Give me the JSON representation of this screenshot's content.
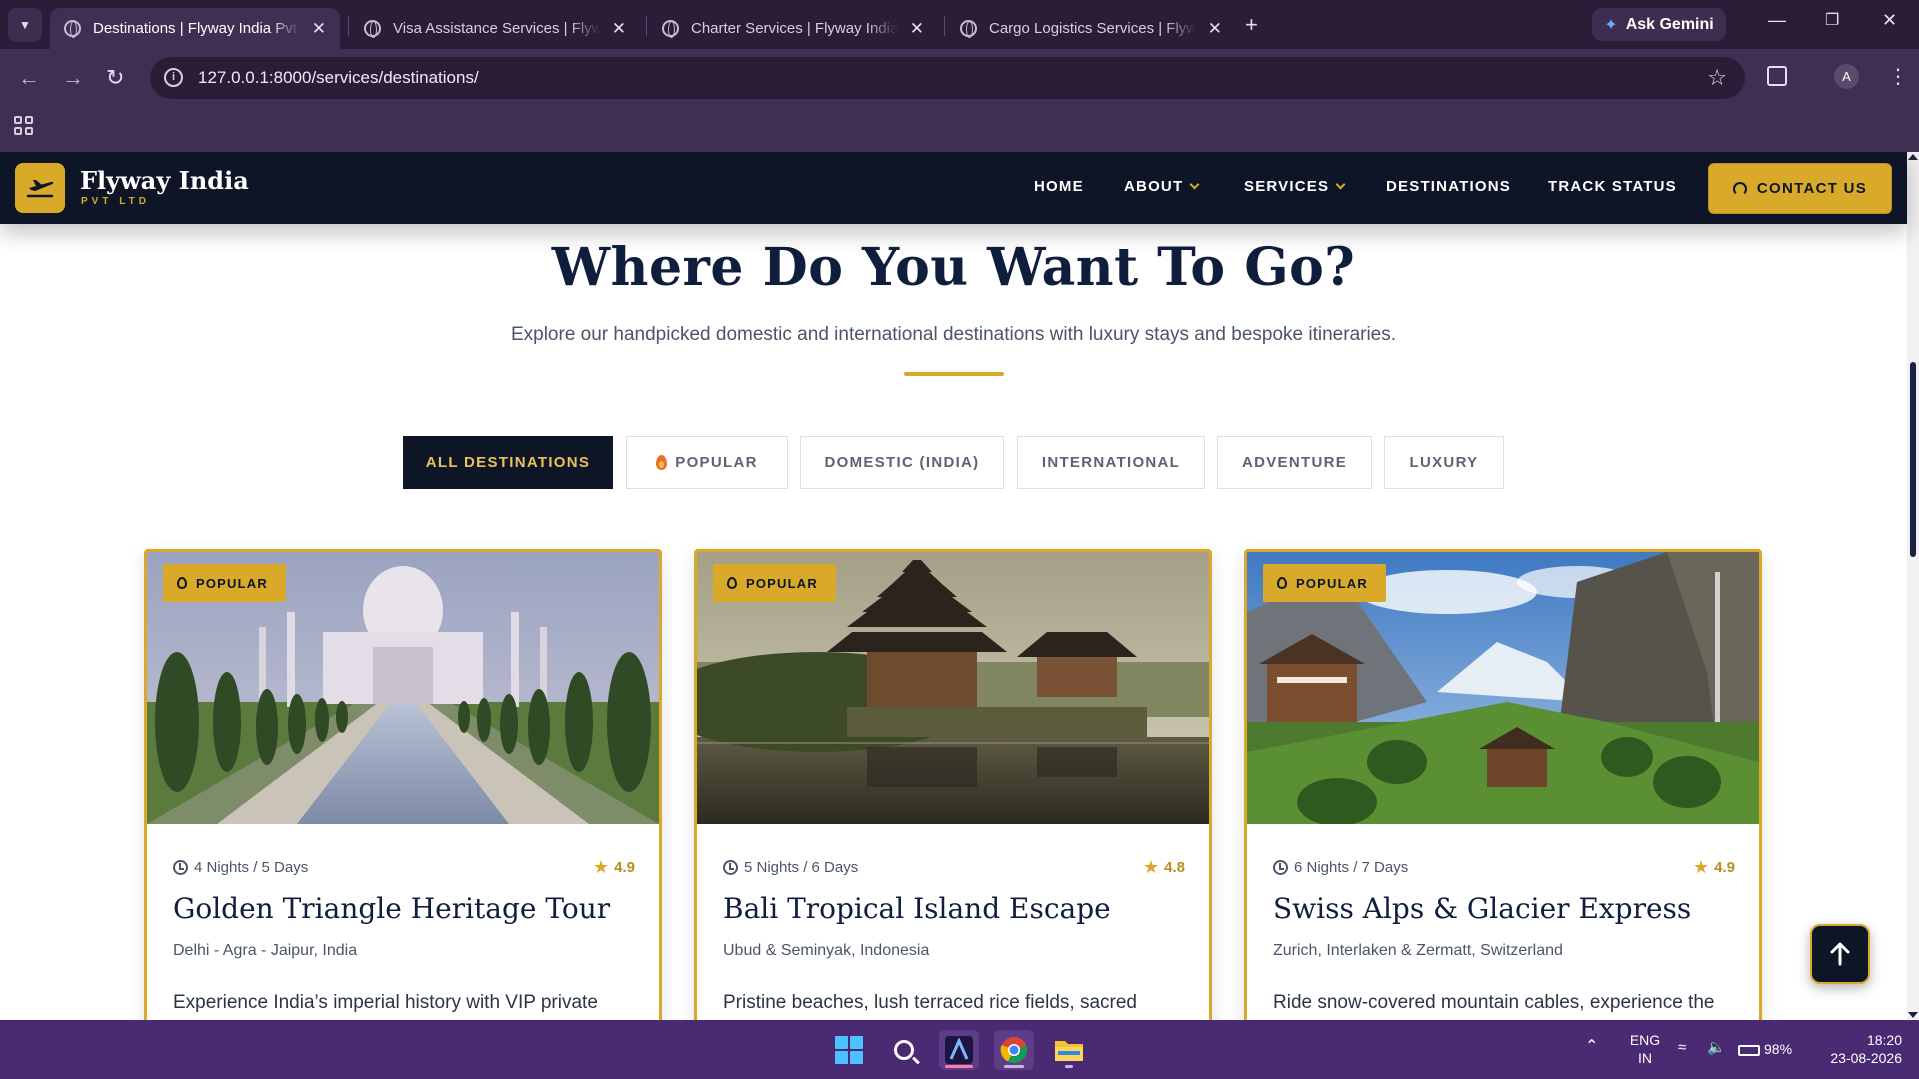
{
  "browser": {
    "tabs": [
      {
        "title": "Destinations | Flyway India Pvt Ltd",
        "active": true
      },
      {
        "title": "Visa Assistance Services | Flyway India",
        "active": false
      },
      {
        "title": "Charter Services | Flyway India Pvt Ltd",
        "active": false
      },
      {
        "title": "Cargo Logistics Services | Flyway India",
        "active": false
      }
    ],
    "ask_gemini": "Ask Gemini",
    "url": "127.0.0.1:8000/services/destinations/",
    "profile_initial": "A"
  },
  "site": {
    "brand": "Flyway India",
    "brand_sub": "PVT LTD",
    "nav": {
      "home": "HOME",
      "about": "ABOUT",
      "services": "SERVICES",
      "destinations": "DESTINATIONS",
      "track": "TRACK STATUS"
    },
    "contact": "CONTACT US"
  },
  "hero": {
    "title": "Where Do You Want To Go?",
    "subtitle": "Explore our handpicked domestic and international destinations with luxury stays and bespoke itineraries."
  },
  "filters": [
    {
      "label": "ALL DESTINATIONS",
      "active": true
    },
    {
      "label": "POPULAR",
      "active": false
    },
    {
      "label": "DOMESTIC (INDIA)",
      "active": false
    },
    {
      "label": "INTERNATIONAL",
      "active": false
    },
    {
      "label": "ADVENTURE",
      "active": false
    },
    {
      "label": "LUXURY",
      "active": false
    }
  ],
  "cards": [
    {
      "badge": "POPULAR",
      "duration": "4 Nights / 5 Days",
      "rating": "4.9",
      "title": "Golden Triangle Heritage Tour",
      "location": "Delhi - Agra - Jaipur, India",
      "description": "Experience India’s imperial history with VIP private"
    },
    {
      "badge": "POPULAR",
      "duration": "5 Nights / 6 Days",
      "rating": "4.8",
      "title": "Bali Tropical Island Escape",
      "location": "Ubud & Seminyak, Indonesia",
      "description": "Pristine beaches, lush terraced rice fields, sacred"
    },
    {
      "badge": "POPULAR",
      "duration": "6 Nights / 7 Days",
      "rating": "4.9",
      "title": "Swiss Alps & Glacier Express",
      "location": "Zurich, Interlaken & Zermatt, Switzerland",
      "description": "Ride snow-covered mountain cables, experience the"
    }
  ],
  "taskbar": {
    "language": "ENG",
    "region": "IN",
    "battery": "98%",
    "time": "18:20",
    "date": "23-08-2026"
  },
  "colors": {
    "gold": "#d9aa2a",
    "navy": "#0d1527",
    "browser_dark": "#2b1d38",
    "taskbar": "#4a2a72"
  }
}
